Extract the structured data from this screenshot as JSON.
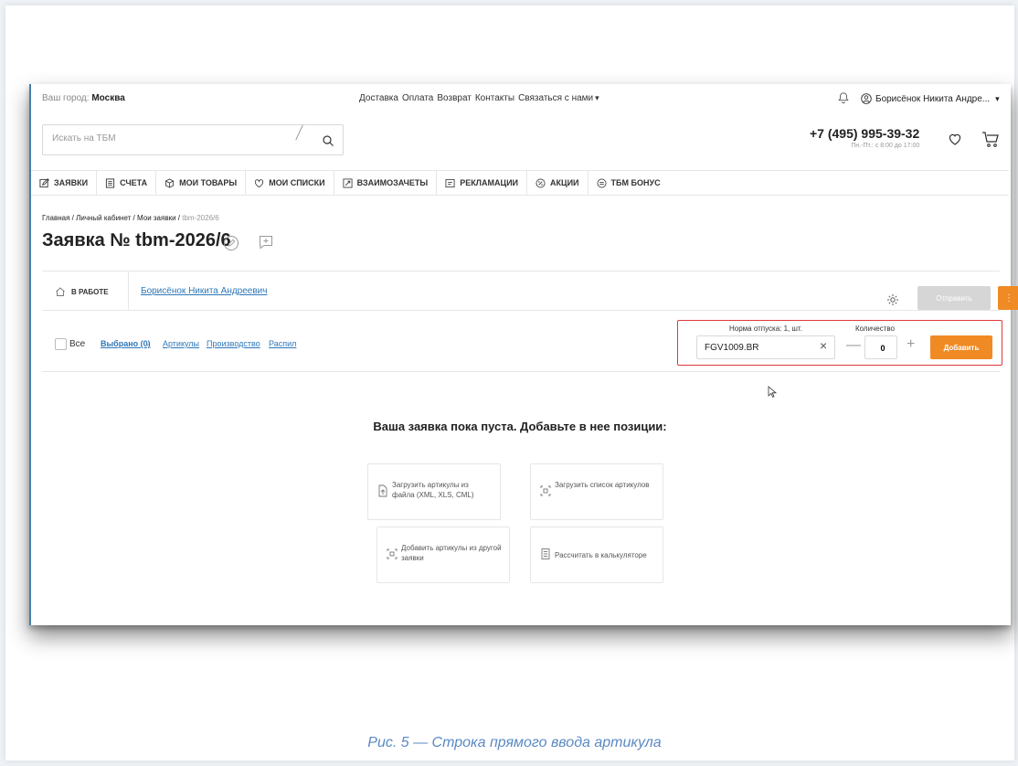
{
  "header": {
    "city_label": "Ваш город:",
    "city_value": "Москва",
    "links": [
      "Доставка",
      "Оплата",
      "Возврат",
      "Контакты",
      "Связаться с нами"
    ],
    "user_name": "Борисёнок Никита Андре..."
  },
  "search": {
    "placeholder": "Искать на ТБМ"
  },
  "contact": {
    "phone": "+7 (495) 995-39-32",
    "hours": "Пн.-Пт.: с 8:00 до 17:00"
  },
  "nav": [
    {
      "label": "ЗАЯВКИ",
      "icon": "edit-icon"
    },
    {
      "label": "СЧЕТА",
      "icon": "document-icon"
    },
    {
      "label": "МОИ ТОВАРЫ",
      "icon": "box-icon"
    },
    {
      "label": "МОИ СПИСКИ",
      "icon": "heart-icon"
    },
    {
      "label": "ВЗАИМОЗАЧЕТЫ",
      "icon": "exchange-icon"
    },
    {
      "label": "РЕКЛАМАЦИИ",
      "icon": "claim-icon"
    },
    {
      "label": "АКЦИИ",
      "icon": "percent-icon"
    },
    {
      "label": "ТБМ БОНУС",
      "icon": "bonus-icon"
    }
  ],
  "breadcrumb": {
    "items": [
      "Главная",
      "Личный кабинет",
      "Мои заявки"
    ],
    "current": "tbm-2026/6",
    "sep": " / "
  },
  "order": {
    "title": "Заявка № tbm-2026/6",
    "status": "В РАБОТЕ",
    "owner": "Борисёнок Никита Андреевич",
    "send_label": "Отправить",
    "more_label": "⋮"
  },
  "filters": {
    "all_label": "Все",
    "selected_label": "Выбрано (0)",
    "links": [
      "Артикулы",
      "Производство",
      "Распил"
    ]
  },
  "add_row": {
    "norm_label": "Норма отпуска: 1, шт.",
    "qty_label": "Количество",
    "article_value": "FGV1009.BR",
    "qty_value": "0",
    "add_label": "Добавить"
  },
  "empty_state": {
    "message": "Ваша заявка пока пуста. Добавьте в нее позиции:",
    "cards": [
      "Загрузить артикулы из файла (XML, XLS, CML)",
      "Загрузить список артикулов",
      "Добавить артикулы из другой заявки",
      "Рассчитать в калькуляторе"
    ]
  },
  "caption": "Рис. 5 — Строка прямого ввода артикула",
  "colors": {
    "accent": "#f08a24",
    "link": "#2e78b8",
    "highlight": "#e03a3a"
  }
}
